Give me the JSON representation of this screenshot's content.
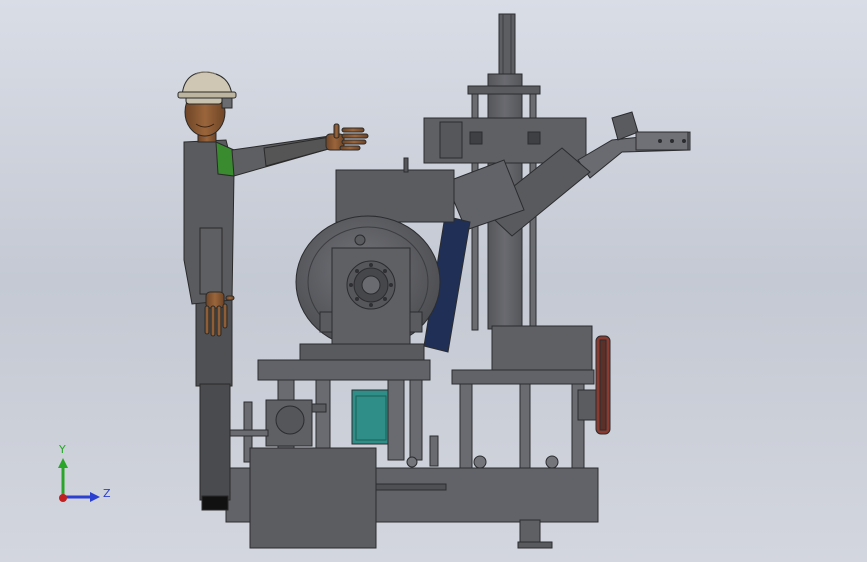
{
  "viewport": {
    "background_top": "#d9dde6",
    "background_bottom": "#c4c9d3"
  },
  "model": {
    "parts": [
      "worker-figure",
      "hard-hat",
      "safety-glasses",
      "machine-frame",
      "flywheel",
      "bearing-housing",
      "gearbox",
      "motor",
      "feed-chute",
      "conveyor-arm",
      "belt-drive-pulley",
      "hydraulic-column",
      "base-frame",
      "output-bin"
    ],
    "colors": {
      "machine": "#5f6064",
      "machine_dark": "#4a4b4f",
      "skin": "#8a5a33",
      "helmet": "#cfc7b4",
      "glove_shoulder": "#3a8a2f",
      "chute": "#1f2f55",
      "pulley": "#8a3a2f",
      "motor_teal": "#2f8f88"
    }
  },
  "triad": {
    "y_label": "Y",
    "z_label": "Z",
    "y_color": "#2aa52a",
    "z_color": "#2b3fd0",
    "x_color": "#c02020"
  }
}
